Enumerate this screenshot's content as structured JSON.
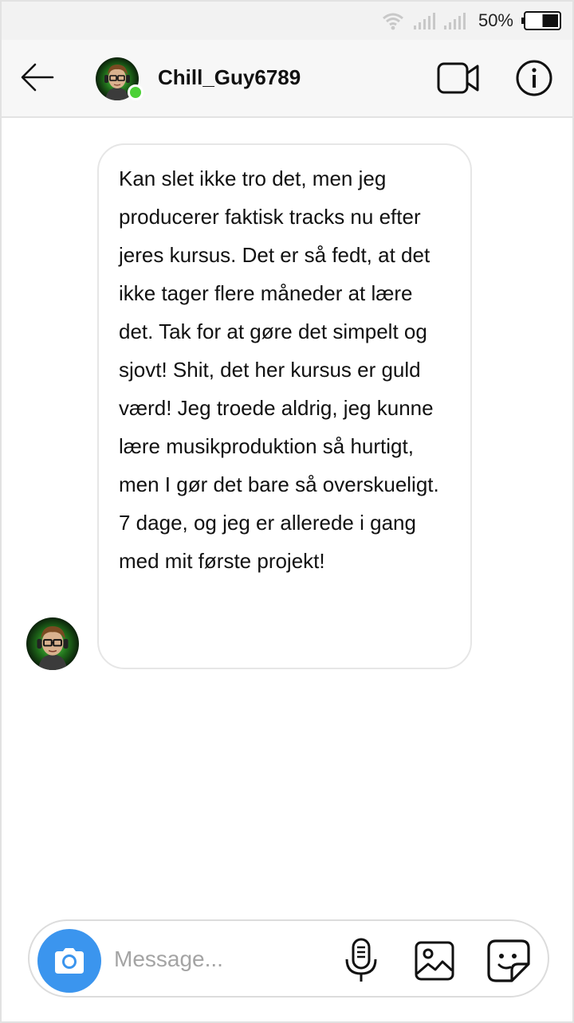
{
  "status_bar": {
    "battery_percent": "50%",
    "battery_level": 0.5,
    "icons": [
      "wifi-icon",
      "signal-icon",
      "signal-icon",
      "battery-icon"
    ]
  },
  "header": {
    "back_icon": "arrow-left-icon",
    "username": "Chill_Guy6789",
    "online": true,
    "online_color": "#4cd137",
    "video_icon": "video-camera-icon",
    "info_icon": "info-icon"
  },
  "thread": {
    "messages": [
      {
        "from": "Chill_Guy6789",
        "text": "Kan slet ikke tro det, men jeg producerer faktisk tracks nu efter jeres kursus. Det er så fedt, at det ikke tager flere måneder at lære det. Tak for at gøre det simpelt og sjovt! Shit, det her kursus er guld værd! Jeg troede aldrig, jeg kunne lære musikproduktion så hurtigt, men I gør det bare så overskueligt. 7 dage, og jeg er allerede i gang med mit første projekt!"
      }
    ]
  },
  "composer": {
    "placeholder": "Message...",
    "value": "",
    "camera_icon": "camera-icon",
    "camera_color": "#3b95ee",
    "mic_icon": "microphone-icon",
    "gallery_icon": "image-icon",
    "sticker_icon": "sticker-icon"
  }
}
